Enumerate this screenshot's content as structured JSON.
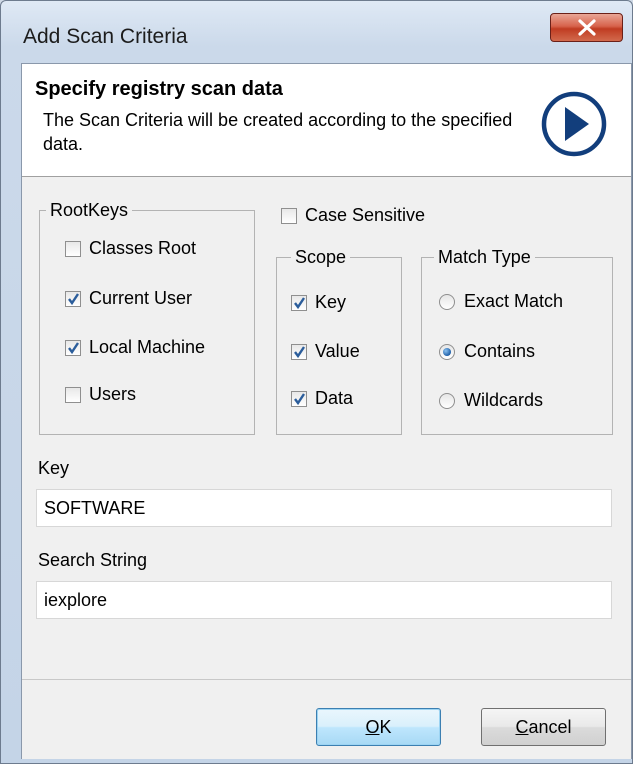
{
  "window": {
    "title": "Add Scan Criteria"
  },
  "header": {
    "title": "Specify registry scan data",
    "description": "The Scan Criteria will be created according to the specified data."
  },
  "rootkeys": {
    "label": "RootKeys",
    "items": [
      {
        "label": "Classes Root",
        "checked": false
      },
      {
        "label": "Current User",
        "checked": true
      },
      {
        "label": "Local Machine",
        "checked": true
      },
      {
        "label": "Users",
        "checked": false
      }
    ]
  },
  "case_sensitive": {
    "label": "Case Sensitive",
    "checked": false
  },
  "scope": {
    "label": "Scope",
    "items": [
      {
        "label": "Key",
        "checked": true
      },
      {
        "label": "Value",
        "checked": true
      },
      {
        "label": "Data",
        "checked": true
      }
    ]
  },
  "match_type": {
    "label": "Match Type",
    "items": [
      {
        "label": "Exact Match",
        "selected": false
      },
      {
        "label": "Contains",
        "selected": true
      },
      {
        "label": "Wildcards",
        "selected": false
      }
    ]
  },
  "key": {
    "label": "Key",
    "value": "SOFTWARE"
  },
  "search_string": {
    "label": "Search String",
    "value": "iexplore"
  },
  "buttons": {
    "ok": {
      "accel": "O",
      "rest": "K"
    },
    "cancel": {
      "accel": "C",
      "rest": "ancel"
    }
  },
  "colors": {
    "accent": "#1f5fa8",
    "check": "#2b5d9b",
    "close": "#c03c22"
  }
}
